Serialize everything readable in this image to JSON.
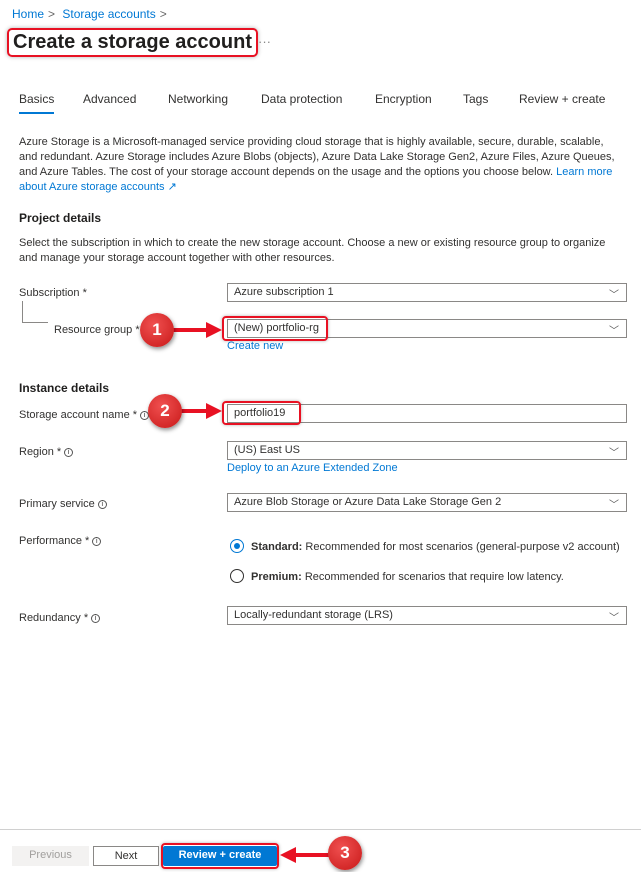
{
  "breadcrumb": [
    "Home",
    "Storage accounts"
  ],
  "page_title": "Create a storage account",
  "more": "···",
  "tabs": [
    "Basics",
    "Advanced",
    "Networking",
    "Data protection",
    "Encryption",
    "Tags",
    "Review + create"
  ],
  "intro": {
    "text": "Azure Storage is a Microsoft-managed service providing cloud storage that is highly available, secure, durable, scalable, and redundant. Azure Storage includes Azure Blobs (objects), Azure Data Lake Storage Gen2, Azure Files, Azure Queues, and Azure Tables. The cost of your storage account depends on the usage and the options you choose below.",
    "link": "Learn more about Azure storage accounts"
  },
  "project": {
    "heading": "Project details",
    "text": "Select the subscription in which to create the new storage account. Choose a new or existing resource group to organize and manage your storage account together with other resources.",
    "subscription_label": "Subscription *",
    "subscription_value": "Azure subscription 1",
    "rg_label": "Resource group *",
    "rg_value": "(New) portfolio-rg",
    "create_new": "Create new"
  },
  "instance": {
    "heading": "Instance details",
    "name_label": "Storage account name *",
    "name_value": "portfolio19",
    "region_label": "Region *",
    "region_value": "(US) East US",
    "region_link": "Deploy to an Azure Extended Zone",
    "service_label": "Primary service",
    "service_value": "Azure Blob Storage or Azure Data Lake Storage Gen 2",
    "perf_label": "Performance *",
    "perf_options": [
      {
        "bold": "Standard:",
        "text": "Recommended for most scenarios (general-purpose v2 account)",
        "selected": true
      },
      {
        "bold": "Premium:",
        "text": "Recommended for scenarios that require low latency.",
        "selected": false
      }
    ],
    "redundancy_label": "Redundancy *",
    "redundancy_value": "Locally-redundant storage (LRS)"
  },
  "footer": {
    "previous": "Previous",
    "next": "Next",
    "review": "Review + create"
  },
  "annotations": [
    "1",
    "2",
    "3"
  ],
  "colors": {
    "accent": "#0078d4",
    "annotation": "#e81123"
  }
}
